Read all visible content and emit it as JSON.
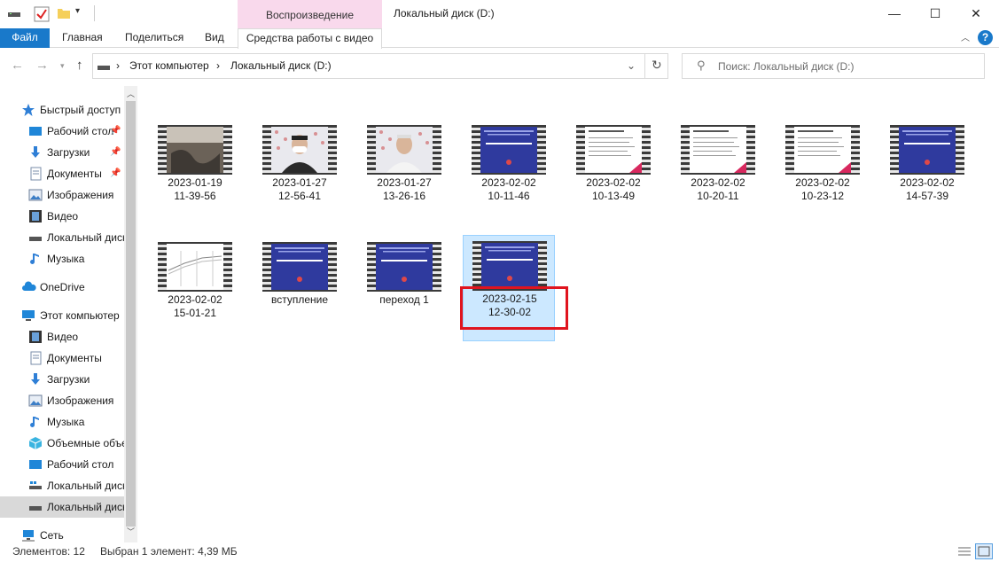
{
  "window": {
    "title": "Локальный диск (D:)",
    "context_tab_header": "Воспроизведение",
    "minimize": "—",
    "maximize": "☐",
    "close": "✕"
  },
  "ribbon": {
    "tabs": [
      "Файл",
      "Главная",
      "Поделиться",
      "Вид",
      "Средства работы с видео"
    ],
    "help": "?"
  },
  "address": {
    "crumbs": [
      "Этот компьютер",
      "Локальный диск (D:)"
    ],
    "search_placeholder": "Поиск: Локальный диск (D:)"
  },
  "sidebar": {
    "items": [
      {
        "label": "Быстрый доступ",
        "icon": "star-icon"
      },
      {
        "label": "Рабочий стол",
        "icon": "desktop-icon"
      },
      {
        "label": "Загрузки",
        "icon": "download-icon"
      },
      {
        "label": "Документы",
        "icon": "documents-icon"
      },
      {
        "label": "Изображения",
        "icon": "pictures-icon"
      },
      {
        "label": "Видео",
        "icon": "video-icon"
      },
      {
        "label": "Локальный диск",
        "icon": "drive-icon"
      },
      {
        "label": "Музыка",
        "icon": "music-icon"
      },
      {
        "label": "OneDrive",
        "icon": "cloud-icon"
      },
      {
        "label": "Этот компьютер",
        "icon": "computer-icon"
      },
      {
        "label": "Видео",
        "icon": "video-icon"
      },
      {
        "label": "Документы",
        "icon": "documents-icon"
      },
      {
        "label": "Загрузки",
        "icon": "download-icon"
      },
      {
        "label": "Изображения",
        "icon": "pictures-icon"
      },
      {
        "label": "Музыка",
        "icon": "music-icon"
      },
      {
        "label": "Объемные объекты",
        "icon": "3d-objects-icon"
      },
      {
        "label": "Рабочий стол",
        "icon": "desktop-icon"
      },
      {
        "label": "Локальный диск",
        "icon": "drive-icon"
      },
      {
        "label": "Локальный диск",
        "icon": "drive-icon"
      },
      {
        "label": "Сеть",
        "icon": "network-icon"
      }
    ]
  },
  "files": [
    {
      "label": "2023-01-19\n11-39-56",
      "thumb": "photo-dark"
    },
    {
      "label": "2023-01-27\n12-56-41",
      "thumb": "person-mask"
    },
    {
      "label": "2023-01-27\n13-26-16",
      "thumb": "person-white"
    },
    {
      "label": "2023-02-02\n10-11-46",
      "thumb": "slide-blue"
    },
    {
      "label": "2023-02-02\n10-13-49",
      "thumb": "slide-white"
    },
    {
      "label": "2023-02-02\n10-20-11",
      "thumb": "slide-white"
    },
    {
      "label": "2023-02-02\n10-23-12",
      "thumb": "slide-white"
    },
    {
      "label": "2023-02-02\n14-57-39",
      "thumb": "slide-blue"
    },
    {
      "label": "2023-02-02\n15-01-21",
      "thumb": "chart-white"
    },
    {
      "label": "вступление",
      "thumb": "slide-blue"
    },
    {
      "label": "переход 1",
      "thumb": "slide-blue"
    },
    {
      "label": "2023-02-15\n12-30-02",
      "thumb": "slide-blue",
      "selected": true
    }
  ],
  "status": {
    "count": "Элементов: 12",
    "selection": "Выбран 1 элемент: 4,39 МБ"
  },
  "colors": {
    "accent": "#1979ca",
    "context_tab": "#f9d9ec",
    "selection": "#cce8ff",
    "highlight": "#e0141e",
    "slide_blue": "#2f3a9e"
  }
}
